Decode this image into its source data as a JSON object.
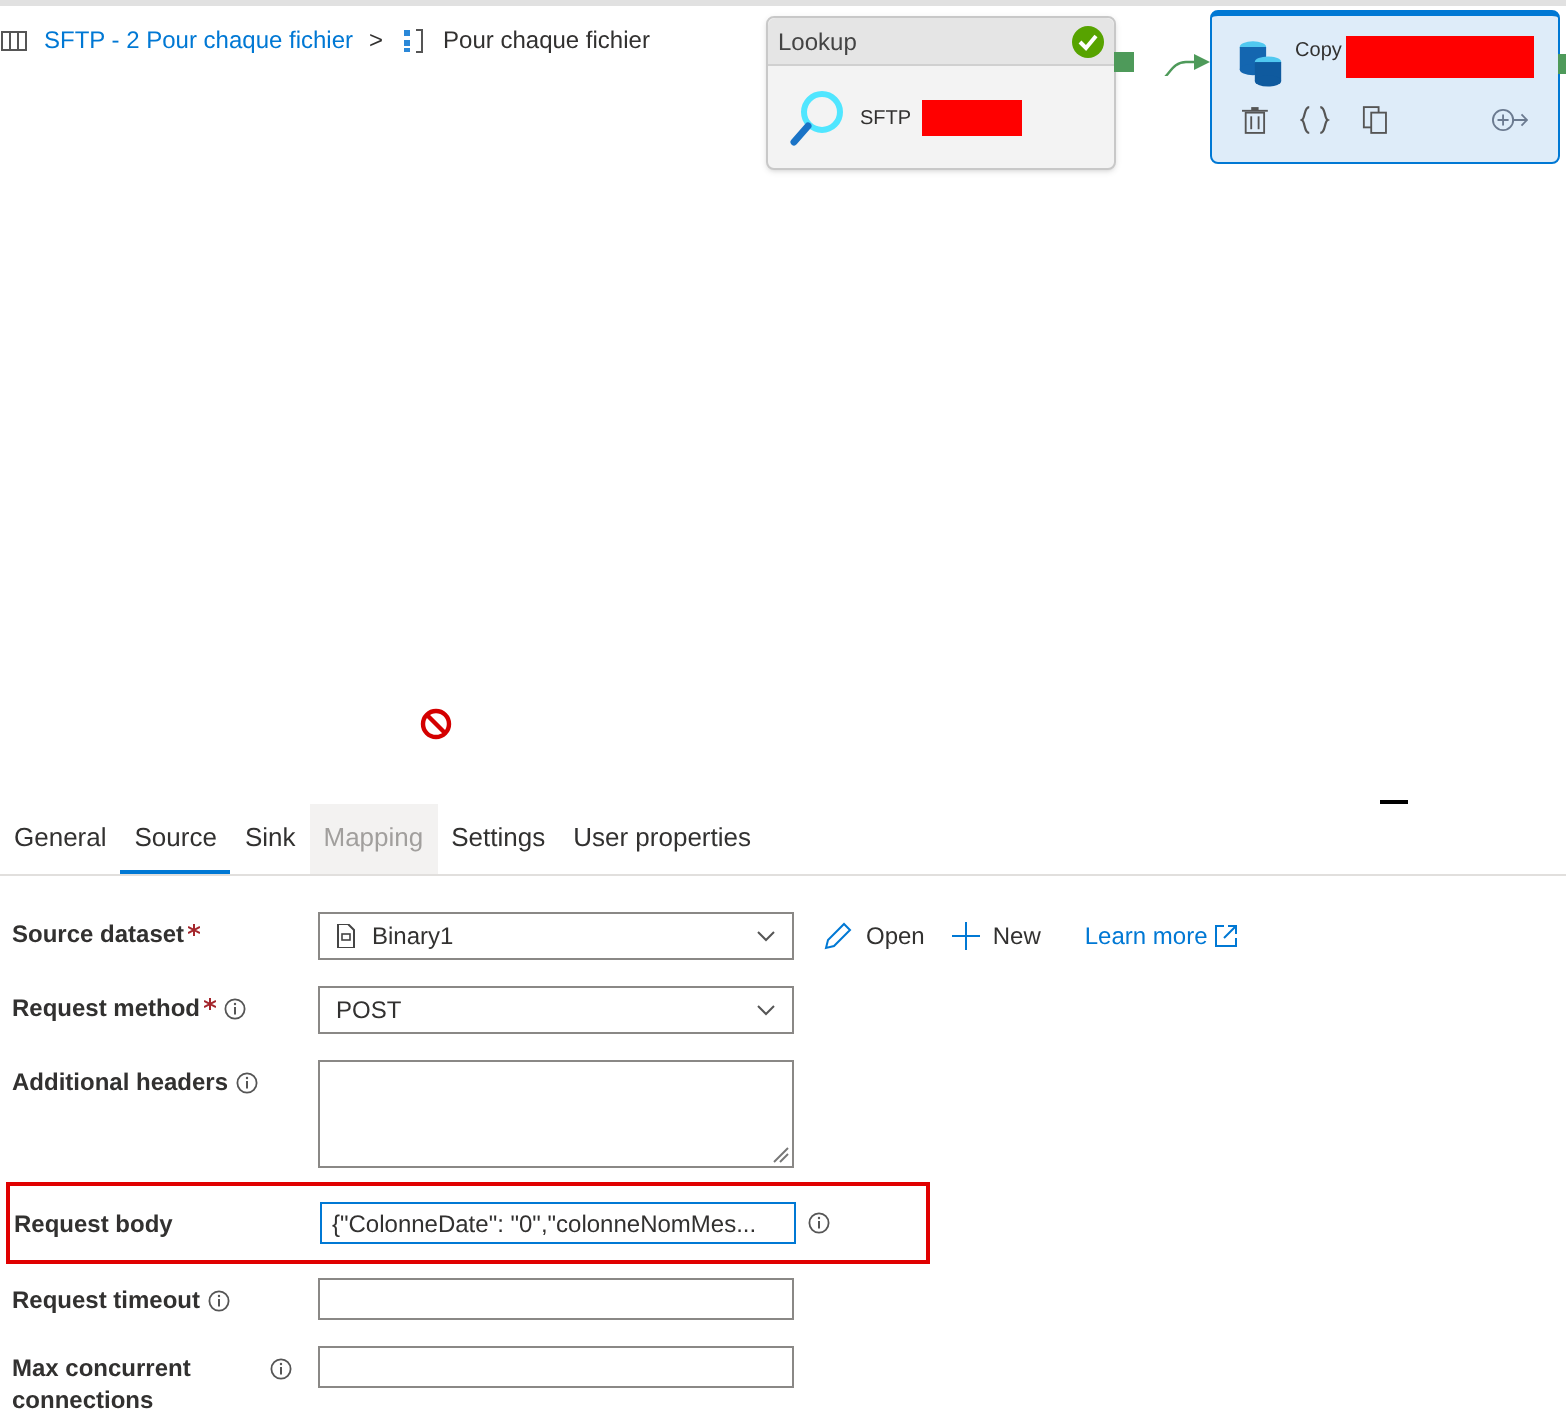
{
  "breadcrumb": {
    "items": [
      {
        "label": "SFTP - 2 Pour chaque fichier",
        "kind": "pipeline"
      },
      {
        "label": "Pour chaque fichier",
        "kind": "foreach"
      }
    ],
    "separator": ">"
  },
  "canvas": {
    "activities": [
      {
        "kind": "lookup",
        "header": "Lookup",
        "name": "SFTP",
        "succeeded": true,
        "selected": false
      },
      {
        "kind": "copy",
        "name": "Copy",
        "selected": true
      }
    ]
  },
  "tabs": [
    {
      "label": "General",
      "selected": false,
      "disabled": false
    },
    {
      "label": "Source",
      "selected": true,
      "disabled": false
    },
    {
      "label": "Sink",
      "selected": false,
      "disabled": false
    },
    {
      "label": "Mapping",
      "selected": false,
      "disabled": true
    },
    {
      "label": "Settings",
      "selected": false,
      "disabled": false
    },
    {
      "label": "User properties",
      "selected": false,
      "disabled": false
    }
  ],
  "fields": [
    {
      "kind": "select",
      "label": "Source dataset",
      "required": true,
      "value": "Binary1",
      "dataset_icon": true,
      "actions": [
        {
          "kind": "edit",
          "label": "Open"
        },
        {
          "kind": "add",
          "label": "New"
        },
        {
          "kind": "link",
          "label": "Learn more"
        }
      ]
    },
    {
      "kind": "select",
      "label": "Request method",
      "required": true,
      "info": true,
      "value": "POST"
    },
    {
      "kind": "textarea",
      "label": "Additional headers",
      "info": true
    },
    {
      "kind": "input",
      "label": "Request body",
      "info": true,
      "value": "{\"ColonneDate\": \"0\",\"colonneNomMes...",
      "focused": true,
      "highlighted": true
    },
    {
      "kind": "input",
      "label": "Request timeout",
      "info": true
    },
    {
      "kind": "input",
      "label": "Max concurrent connections",
      "info": true
    }
  ]
}
